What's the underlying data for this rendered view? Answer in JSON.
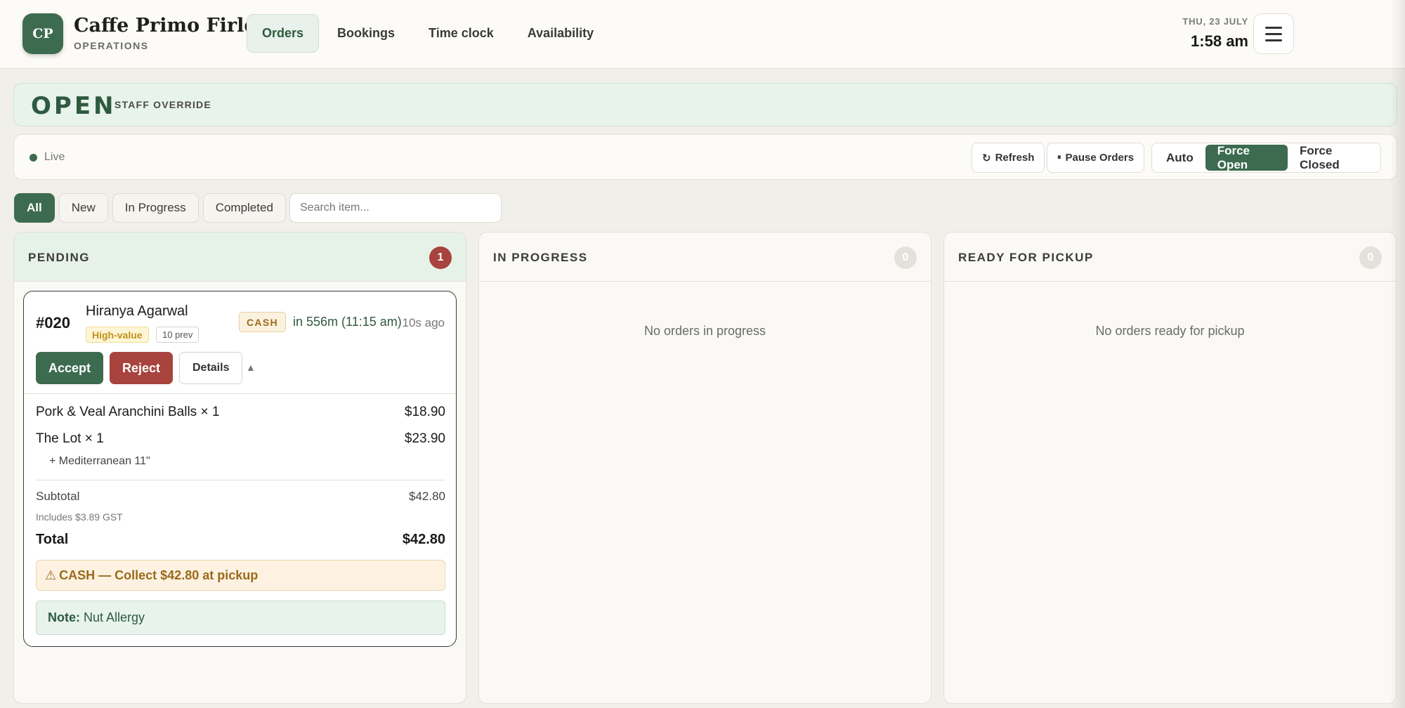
{
  "header": {
    "logo": "CP",
    "brand_name": "Caffe Primo Firle",
    "brand_sub": "OPERATIONS",
    "nav": [
      {
        "label": "Orders",
        "active": true
      },
      {
        "label": "Bookings"
      },
      {
        "label": "Time clock"
      },
      {
        "label": "Availability"
      }
    ],
    "date": "THU, 23 JULY",
    "time": "1:58 am",
    "menu_icon": "hamburger-icon"
  },
  "banner": {
    "status": "OPEN",
    "tag": "STAFF OVERRIDE"
  },
  "controls": {
    "live_label": "Live",
    "refresh_label": "Refresh",
    "refresh_icon": "↻",
    "pause_label": "Pause Orders",
    "pause_icon": "⏸",
    "modes": [
      "Auto",
      "Force Open",
      "Force Closed"
    ],
    "active_mode": "Force Open"
  },
  "filters": {
    "chips": [
      "All",
      "New",
      "In Progress",
      "Completed"
    ],
    "active": "All",
    "search_placeholder": "Search item..."
  },
  "columns": [
    {
      "title": "PENDING",
      "count": "1",
      "empty": ""
    },
    {
      "title": "IN PROGRESS",
      "count": "0",
      "empty": "No orders in progress"
    },
    {
      "title": "READY FOR PICKUP",
      "count": "0",
      "empty": "No orders ready for pickup"
    }
  ],
  "order": {
    "number": "#020",
    "customer": "Hiranya Agarwal",
    "badge_value": "High-value",
    "badge_prev": "10 prev",
    "payment": "CASH",
    "eta": "in 556m (11:15 am)",
    "ago": "10s ago",
    "accept": "Accept",
    "reject": "Reject",
    "details": "Details",
    "toggle": "▲",
    "items": [
      {
        "name": "Pork & Veal Aranchini Balls × 1",
        "price": "$18.90"
      },
      {
        "name": "The Lot × 1",
        "price": "$23.90",
        "modifier": "+ Mediterranean 11\""
      }
    ],
    "subtotal_label": "Subtotal",
    "subtotal": "$42.80",
    "gst": "Includes $3.89 GST",
    "total_label": "Total",
    "total": "$42.80",
    "cash_icon": "⚠",
    "cash_note": "CASH — Collect $42.80 at pickup",
    "note_label": "Note:",
    "note": "Nut Allergy"
  },
  "colors": {
    "accent": "#3d6b4f",
    "danger": "#a8433d",
    "warning": "#9a6a1a"
  }
}
